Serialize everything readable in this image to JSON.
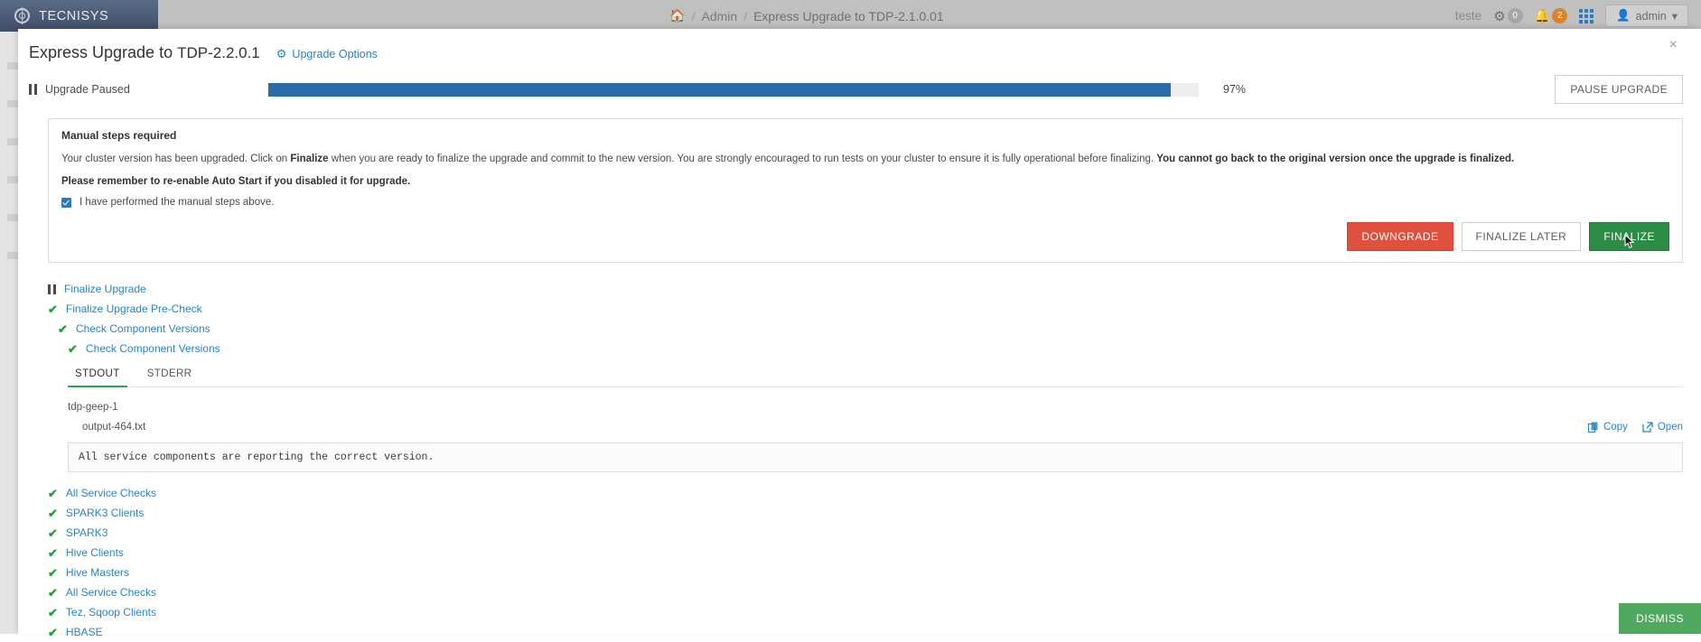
{
  "topbar": {
    "brand": "TECNISYS",
    "brand_icon": "compass-logo-icon",
    "home_icon": "home-icon",
    "breadcrumb": {
      "admin": "Admin",
      "current": "Express Upgrade to TDP-2.1.0.01",
      "separator": "/"
    },
    "user_context": "teste",
    "ops_badge": "0",
    "alerts_badge": "2",
    "gear_icon": "gear-icon",
    "bell_icon": "bell-icon",
    "grid_icon": "grid-apps-icon",
    "admin_label": "admin",
    "admin_caret": "▾"
  },
  "modal": {
    "close_icon": "×",
    "title_prefix": "Express Upgrade to",
    "title_version": "TDP-2.2.0.1",
    "upgrade_options_label": "Upgrade Options",
    "upgrade_options_icon": "gears-icon"
  },
  "progress": {
    "status_label": "Upgrade Paused",
    "status_icon": "pause-icon",
    "percent_label": "97%",
    "percent_value": 97,
    "bar_color": "#2a6ba8",
    "pause_button": "PAUSE UPGRADE"
  },
  "manual_steps": {
    "title": "Manual steps required",
    "body_part1": "Your cluster version has been upgraded. Click on ",
    "body_bold1": "Finalize",
    "body_part2": " when you are ready to finalize the upgrade and commit to the new version. You are strongly encouraged to run tests on your cluster to ensure it is fully operational before finalizing. ",
    "body_bold2": "You cannot go back to the original version once the upgrade is finalized.",
    "reminder": "Please remember to re-enable Auto Start if you disabled it for upgrade.",
    "checkbox_label": "I have performed the manual steps above.",
    "checkbox_checked": true,
    "buttons": {
      "downgrade": "DOWNGRADE",
      "finalize_later": "FINALIZE LATER",
      "finalize": "FINALIZE"
    },
    "colors": {
      "downgrade": "#e0503f",
      "finalize": "#2c8b45"
    }
  },
  "tree": [
    {
      "label": "Finalize Upgrade",
      "icon": "pause-icon",
      "level": 0
    },
    {
      "label": "Finalize Upgrade Pre-Check",
      "icon": "check-icon",
      "level": 0
    },
    {
      "label": "Check Component Versions",
      "icon": "check-icon",
      "level": 1
    },
    {
      "label": "Check Component Versions",
      "icon": "check-icon",
      "level": 2
    }
  ],
  "output": {
    "tabs": [
      {
        "label": "STDOUT",
        "active": true
      },
      {
        "label": "STDERR",
        "active": false
      }
    ],
    "host": "tdp-geep-1",
    "file_name": "output-464.txt",
    "copy_label": "Copy",
    "copy_icon": "copy-icon",
    "open_label": "Open",
    "open_icon": "external-link-icon",
    "content": "All service components are reporting the correct version."
  },
  "tree_bottom": [
    {
      "label": "All Service Checks",
      "icon": "check-icon"
    },
    {
      "label": "SPARK3 Clients",
      "icon": "check-icon"
    },
    {
      "label": "SPARK3",
      "icon": "check-icon"
    },
    {
      "label": "Hive Clients",
      "icon": "check-icon"
    },
    {
      "label": "Hive Masters",
      "icon": "check-icon"
    },
    {
      "label": "All Service Checks",
      "icon": "check-icon"
    },
    {
      "label": "Tez, Sqoop Clients",
      "icon": "check-icon"
    },
    {
      "label": "HBASE",
      "icon": "check-icon"
    }
  ],
  "footer": {
    "dismiss": "DISMISS",
    "dismiss_color": "#4fa95f"
  }
}
